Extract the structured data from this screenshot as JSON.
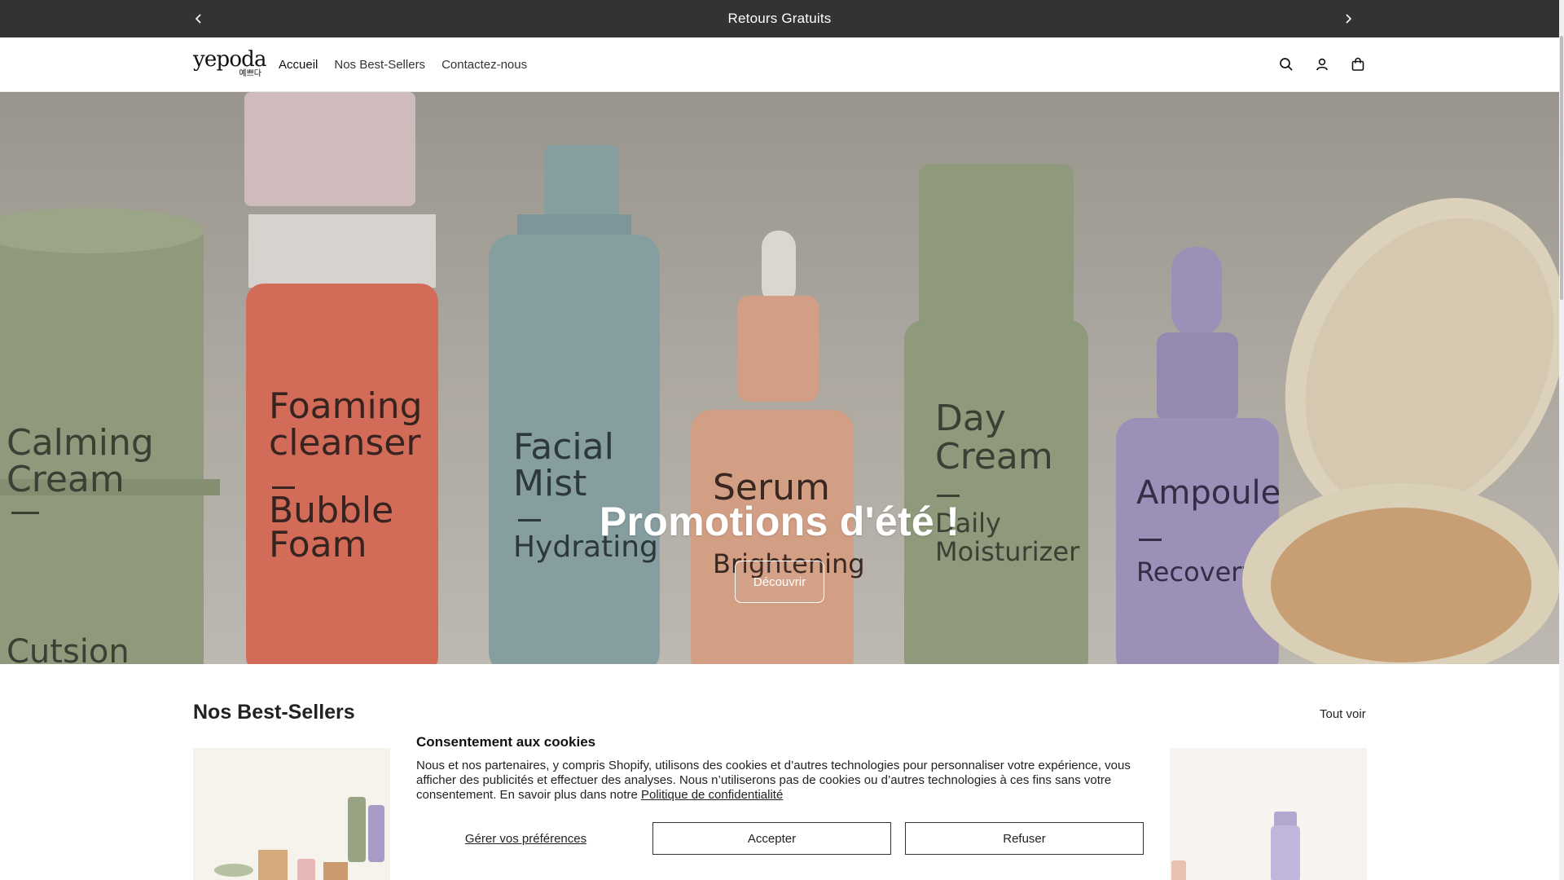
{
  "announcement": {
    "text": "Retours Gratuits",
    "prev_icon": "chevron-left-icon",
    "next_icon": "chevron-right-icon"
  },
  "header": {
    "logo_text": "yepoda",
    "logo_sub": "예쁘다",
    "nav": [
      {
        "label": "Accueil"
      },
      {
        "label": "Nos Best-Sellers"
      },
      {
        "label": "Contactez-nous"
      }
    ],
    "icons": [
      "search-icon",
      "account-icon",
      "cart-icon"
    ]
  },
  "hero": {
    "title": "Promotions d'été !",
    "button_label": "Découvrir",
    "image_labels": {
      "calming": [
        "Calming",
        "Cream",
        "Cutsion"
      ],
      "foaming": [
        "Foaming",
        "cleanser",
        "Bubble",
        "Foam"
      ],
      "mist": [
        "Facial",
        "Mist",
        "Hydrating"
      ],
      "serum": [
        "Serum",
        "Brightening"
      ],
      "daycream": [
        "Day",
        "Cream",
        "Daily",
        "Moisturizer"
      ],
      "ampoule": [
        "Ampoule",
        "Recovery"
      ]
    }
  },
  "bestsellers": {
    "title": "Nos Best-Sellers",
    "see_all": "Tout voir"
  },
  "cookie": {
    "title": "Consentement aux cookies",
    "body": "Nous et nos partenaires, y compris Shopify, utilisons des cookies et d’autres technologies pour personnaliser votre expérience, vous afficher des publicités et effectuer des analyses. Nous n’utiliserons pas de cookies ou d’autres technologies à ces fins sans votre consentement. En savoir plus dans notre ",
    "policy_link": "Politique de confidentialité",
    "manage_label": "Gérer vos préférences",
    "accept_label": "Accepter",
    "refuse_label": "Refuser"
  },
  "colors": {
    "announcement_bg": "#333333",
    "green": "#98a383",
    "coral": "#e0735f",
    "blue": "#8fa8ab",
    "peach": "#e0a98e",
    "lilac": "#a79ac4",
    "cream": "#eadfc7"
  }
}
